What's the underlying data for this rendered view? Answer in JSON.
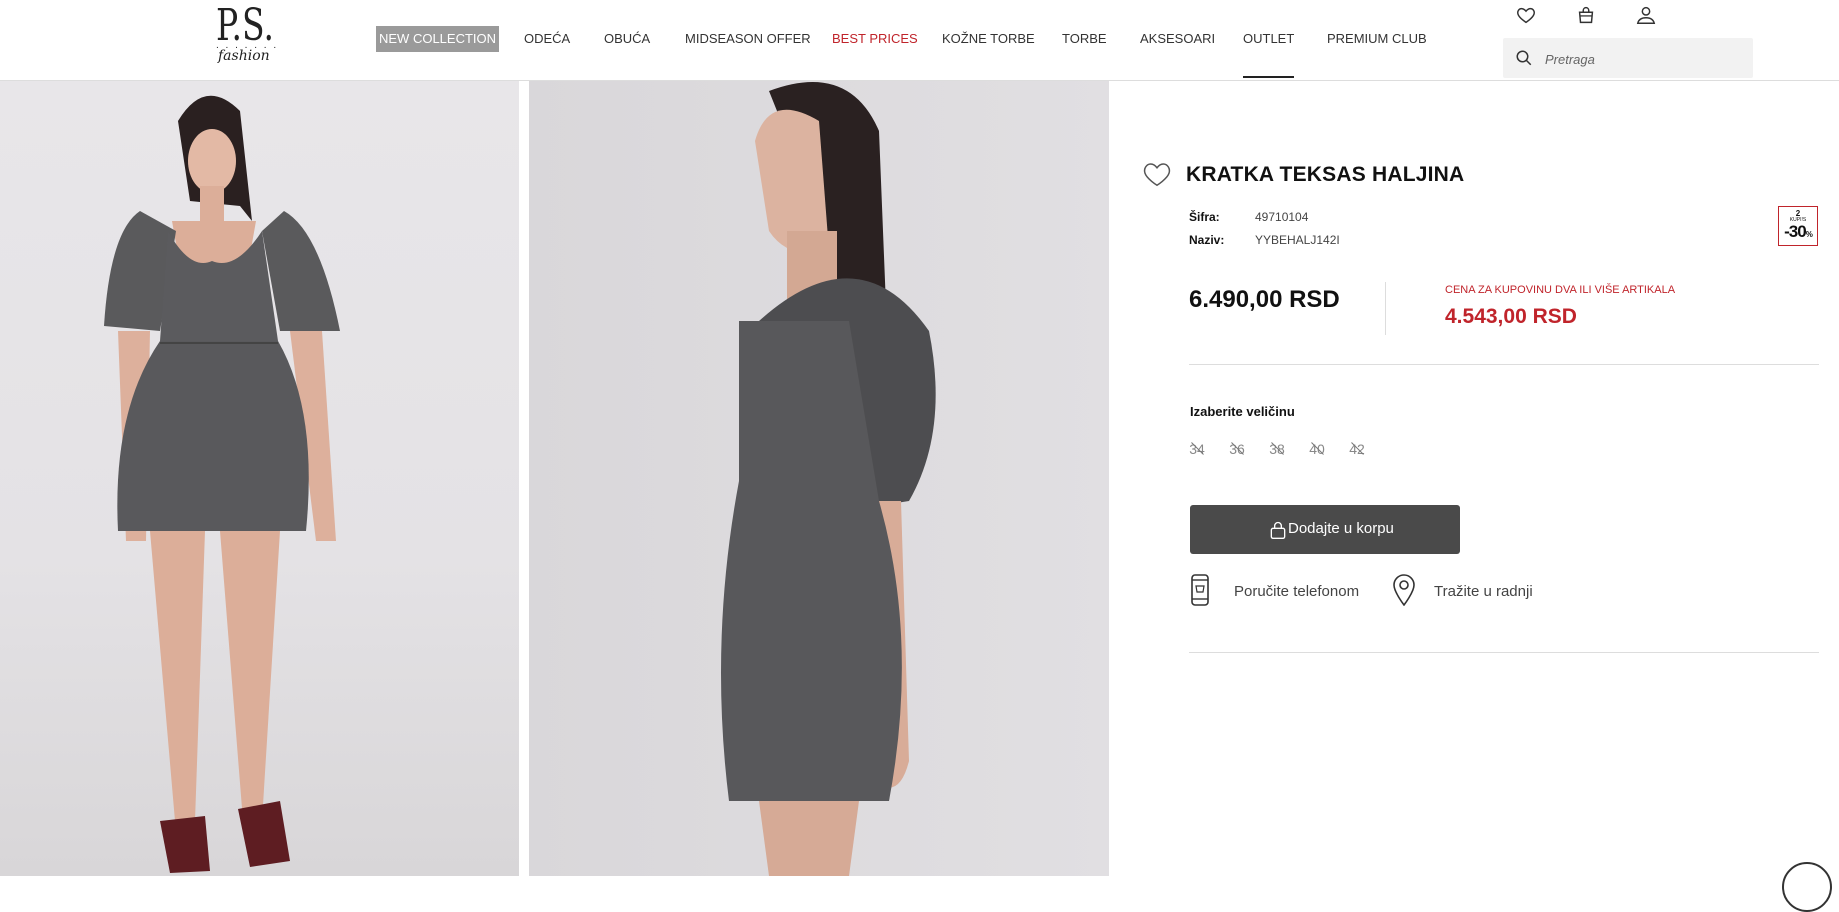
{
  "header": {
    "logo": {
      "letters": "P.S.",
      "dots": ". . . . . . .",
      "script": "fashion"
    },
    "nav": [
      {
        "label": "NEW COLLECTION",
        "style": "highlight"
      },
      {
        "label": "ODEĆA",
        "style": "normal"
      },
      {
        "label": "OBUĆA",
        "style": "normal"
      },
      {
        "label": "MIDSEASON OFFER",
        "style": "normal"
      },
      {
        "label": "BEST PRICES",
        "style": "red"
      },
      {
        "label": "KOŽNE TORBE",
        "style": "normal"
      },
      {
        "label": "TORBE",
        "style": "normal"
      },
      {
        "label": "AKSESOARI",
        "style": "normal"
      },
      {
        "label": "OUTLET",
        "style": "active"
      },
      {
        "label": "PREMIUM CLUB",
        "style": "normal"
      }
    ],
    "icons": [
      "heart-icon",
      "bag-icon",
      "user-icon"
    ],
    "search": {
      "placeholder": "Pretraga",
      "value": ""
    }
  },
  "product": {
    "title": "KRATKA TEKSAS HALJINA",
    "meta": [
      {
        "label": "Šifra:",
        "value": "49710104"
      },
      {
        "label": "Naziv:",
        "value": "YYBEHALJ142I"
      }
    ],
    "badge": {
      "top": "2",
      "sub": "KUPI!S",
      "discount": "-30",
      "unit": "%"
    },
    "price": "6.490,00 RSD",
    "promo_label": "CENA ZA KUPOVINU DVA ILI VIŠE ARTIKALA",
    "promo_price": "4.543,00 RSD",
    "size_label": "Izaberite veličinu",
    "sizes": [
      "34",
      "36",
      "38",
      "40",
      "42"
    ],
    "add_to_cart": "Dodajte u korpu",
    "order_phone": "Poručite telefonom",
    "find_in_store": "Tražite u radnji"
  },
  "colors": {
    "accent_red": "#c0242b",
    "button_dark": "#4a4a4a",
    "nav_highlight": "#9a9a9a"
  }
}
